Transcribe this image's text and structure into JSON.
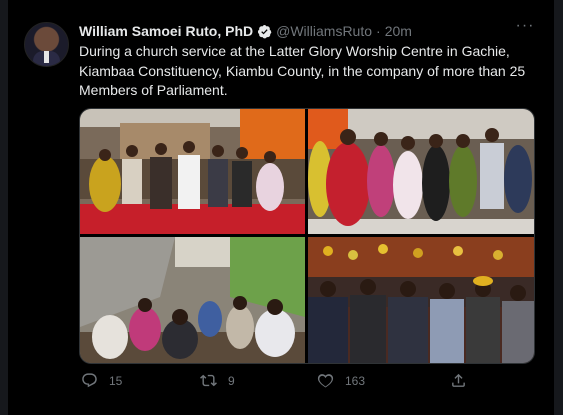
{
  "tweet": {
    "author_name": "William Samoei Ruto, PhD",
    "handle": "@WilliamsRuto",
    "separator": "·",
    "time": "20m",
    "text": "During a church service at the Latter Glory Worship Centre in Gachie, Kiambaa Constituency, Kiambu County, in the company of more than 25 Members of Parliament.",
    "verified_icon": "verified-badge-icon",
    "more_icon": "more-options-icon"
  },
  "media": {
    "photos": [
      {
        "id": "church-stage-photo",
        "kind": "photo"
      },
      {
        "id": "women-singing-photo",
        "kind": "photo"
      },
      {
        "id": "crowd-outside-photo",
        "kind": "photo"
      },
      {
        "id": "congregation-seated-photo",
        "kind": "photo"
      }
    ]
  },
  "actions": {
    "reply_count": "15",
    "retweet_count": "9",
    "like_count": "163",
    "icons": [
      "reply-icon",
      "retweet-icon",
      "like-icon",
      "share-icon"
    ]
  },
  "colors": {
    "background": "#000000",
    "text": "#e7e9ea",
    "secondary": "#71767b",
    "verified": "#1d9bf0"
  }
}
